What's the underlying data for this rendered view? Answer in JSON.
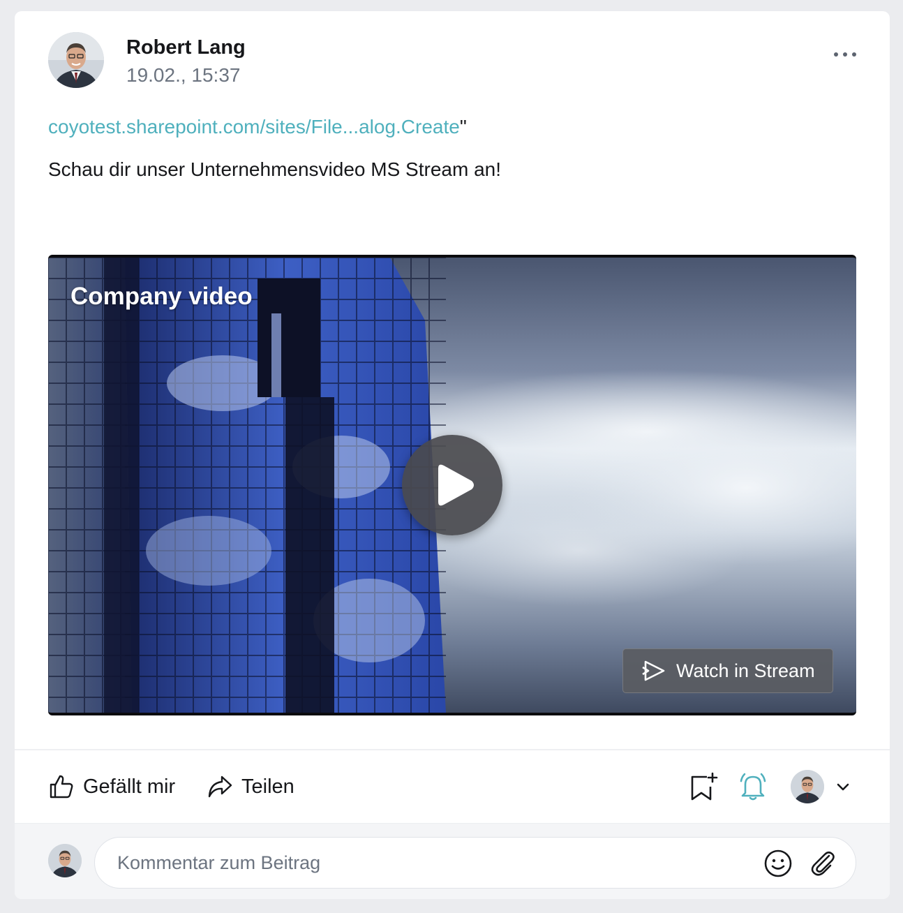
{
  "post": {
    "author_name": "Robert Lang",
    "timestamp": "19.02., 15:37",
    "link_text": "coyotest.sharepoint.com/sites/File...alog.Create",
    "link_suffix": "\"",
    "body_text": "Schau dir unser Unternehmensvideo MS Stream an!"
  },
  "video": {
    "title": "Company video",
    "watch_label": "Watch in Stream"
  },
  "actions": {
    "like_label": "Gefällt mir",
    "share_label": "Teilen"
  },
  "comment": {
    "placeholder": "Kommentar zum Beitrag"
  },
  "icons": {
    "more": "more-horizontal-icon",
    "play": "play-icon",
    "stream": "stream-play-icon",
    "like": "thumbs-up-icon",
    "share": "share-arrow-icon",
    "bookmark": "bookmark-add-icon",
    "bell": "bell-icon",
    "chevron": "chevron-down-icon",
    "emoji": "emoji-icon",
    "attach": "paperclip-icon"
  },
  "colors": {
    "link": "#4fb0bd",
    "bell_active": "#4fb0bd",
    "page_background": "#ebecef"
  }
}
